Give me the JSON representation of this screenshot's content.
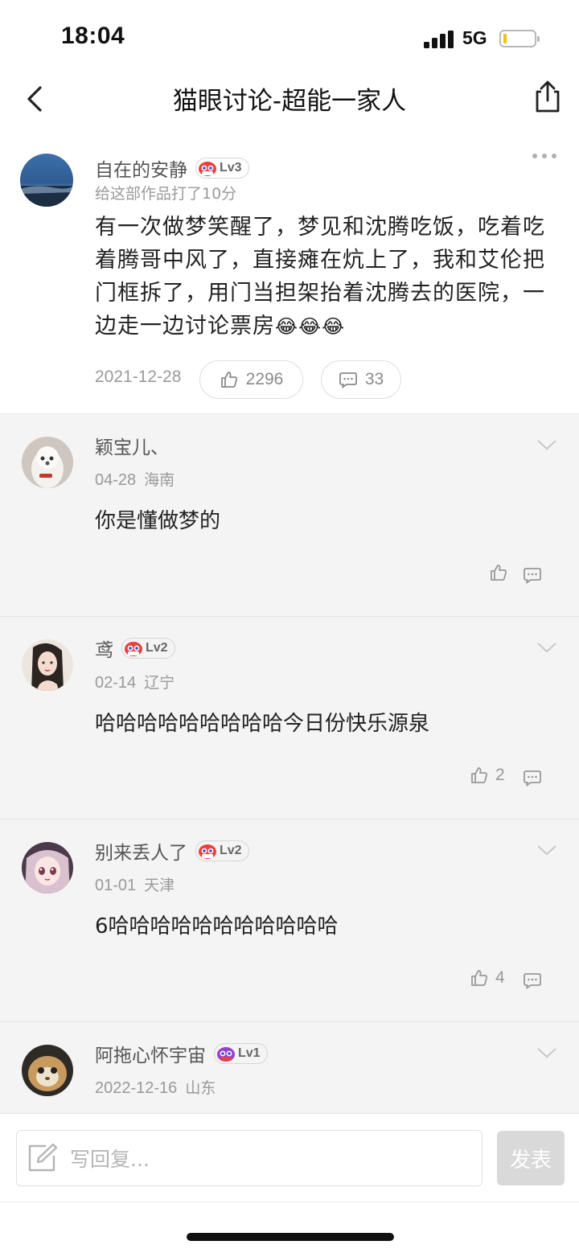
{
  "status_bar": {
    "time": "18:04",
    "network": "5G"
  },
  "header": {
    "title": "猫眼讨论-超能一家人"
  },
  "post": {
    "username": "自在的安静",
    "level": "Lv3",
    "score_text": "给这部作品打了10分",
    "content": "有一次做梦笑醒了，梦见和沈腾吃饭，吃着吃着腾哥中风了，直接瘫在炕上了，我和艾伦把门框拆了，用门当担架抬着沈腾去的医院，一边走一边讨论票房",
    "emojis": "😂😂😂",
    "date": "2021-12-28",
    "likes": "2296",
    "comments": "33"
  },
  "comments": [
    {
      "username": "颖宝儿、",
      "level": "",
      "date": "04-28",
      "location": "海南",
      "text": "你是懂做梦的",
      "likes": ""
    },
    {
      "username": "鸢",
      "level": "Lv2",
      "date": "02-14",
      "location": "辽宁",
      "text": "哈哈哈哈哈哈哈哈哈今日份快乐源泉",
      "likes": "2"
    },
    {
      "username": "别来丢人了",
      "level": "Lv2",
      "date": "01-01",
      "location": "天津",
      "text": "6哈哈哈哈哈哈哈哈哈哈哈",
      "likes": "4"
    },
    {
      "username": "阿拖心怀宇宙",
      "level": "Lv1",
      "date": "2022-12-16",
      "location": "山东",
      "text": "",
      "likes": ""
    }
  ],
  "reply_bar": {
    "placeholder": "写回复...",
    "send_label": "发表"
  },
  "icons": {
    "back": "chevron-left-icon",
    "share": "share-icon",
    "more": "more-dots-icon",
    "like": "thumbs-up-icon",
    "comment": "comment-bubble-icon",
    "expand": "chevron-down-icon",
    "edit": "edit-icon"
  },
  "colors": {
    "text_primary": "#222222",
    "text_secondary": "#999999",
    "comment_bg": "#f4f4f4",
    "send_button": "#d9d9d9",
    "level_badge_red": "#e8413e"
  }
}
